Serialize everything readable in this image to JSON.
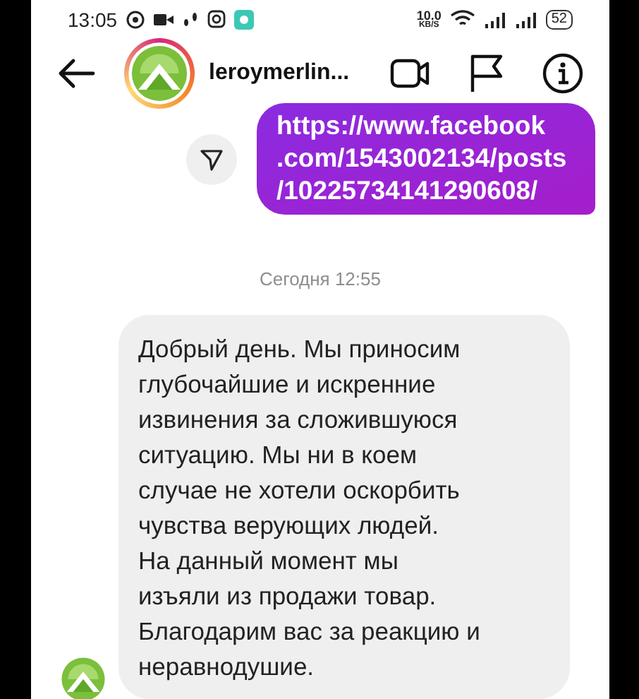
{
  "status_bar": {
    "time": "13:05",
    "speed": "10.0",
    "speed_unit": "KB/S",
    "battery": "52"
  },
  "header": {
    "username": "leroymerlin..."
  },
  "messages": [
    {
      "kind": "outgoing",
      "lines": [
        "https://www.facebook",
        ".com/1543002134/posts",
        "/10225734141290608/"
      ]
    },
    {
      "kind": "timestamp",
      "text": "Сегодня 12:55"
    },
    {
      "kind": "incoming",
      "lines": [
        "Добрый день. Мы приносим",
        "глубочайшие и искренние",
        "извинения за сложившуюся",
        "ситуацию. Мы ни в коем",
        "случае не хотели оскорбить",
        "чувства верующих людей.",
        "На данный момент мы",
        "изъяли из продажи товар.",
        "Благодарим вас за реакцию и",
        "неравнодушие."
      ]
    }
  ]
}
